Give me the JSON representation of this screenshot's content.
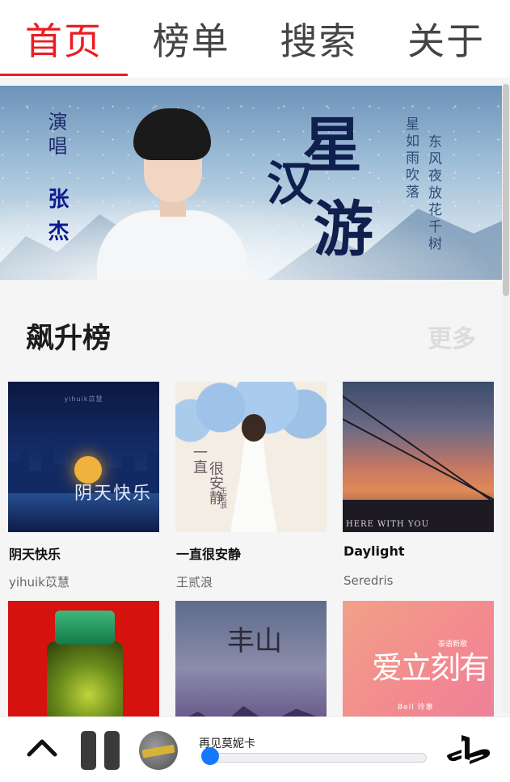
{
  "nav": {
    "tabs": [
      {
        "label": "首页",
        "active": true
      },
      {
        "label": "榜单",
        "active": false
      },
      {
        "label": "搜索",
        "active": false
      },
      {
        "label": "关于",
        "active": false
      }
    ],
    "accent_color": "#ec1c24"
  },
  "banner": {
    "singer_label": "演唱",
    "singer_name": "张杰",
    "title_chars": [
      "星",
      "汉",
      "游"
    ],
    "lyric_line1": "星如雨吹落",
    "lyric_line2": "东风夜放花千树"
  },
  "section": {
    "title": "飙升榜",
    "more_label": "更多"
  },
  "songs": [
    {
      "name": "阴天快乐",
      "artist": "yihuik苡慧",
      "cover_text": "阴天快乐",
      "cover_top": "yihuik苡慧"
    },
    {
      "name": "一直很安静",
      "artist": "王贰浪",
      "cover_text_1": "一直",
      "cover_text_2": "很安静",
      "cover_text_3": "王贰浪"
    },
    {
      "name": "Daylight",
      "artist": "Seredris",
      "cover_text": "HERE WITH YOU"
    },
    {
      "name": "",
      "artist": ""
    },
    {
      "name": "",
      "artist": "",
      "cover_text": "丰山"
    },
    {
      "name": "",
      "artist": "",
      "cover_text": "爱立刻有",
      "cover_small": "泰语新歌",
      "cover_bell": "Bell 玲惠"
    }
  ],
  "player": {
    "song_title": "再见莫妮卡",
    "progress": 0.03,
    "accent_color": "#1677ff"
  },
  "icons": {
    "expand": "chevron-up-icon",
    "pause": "pause-icon",
    "logo": "playstation-icon"
  }
}
